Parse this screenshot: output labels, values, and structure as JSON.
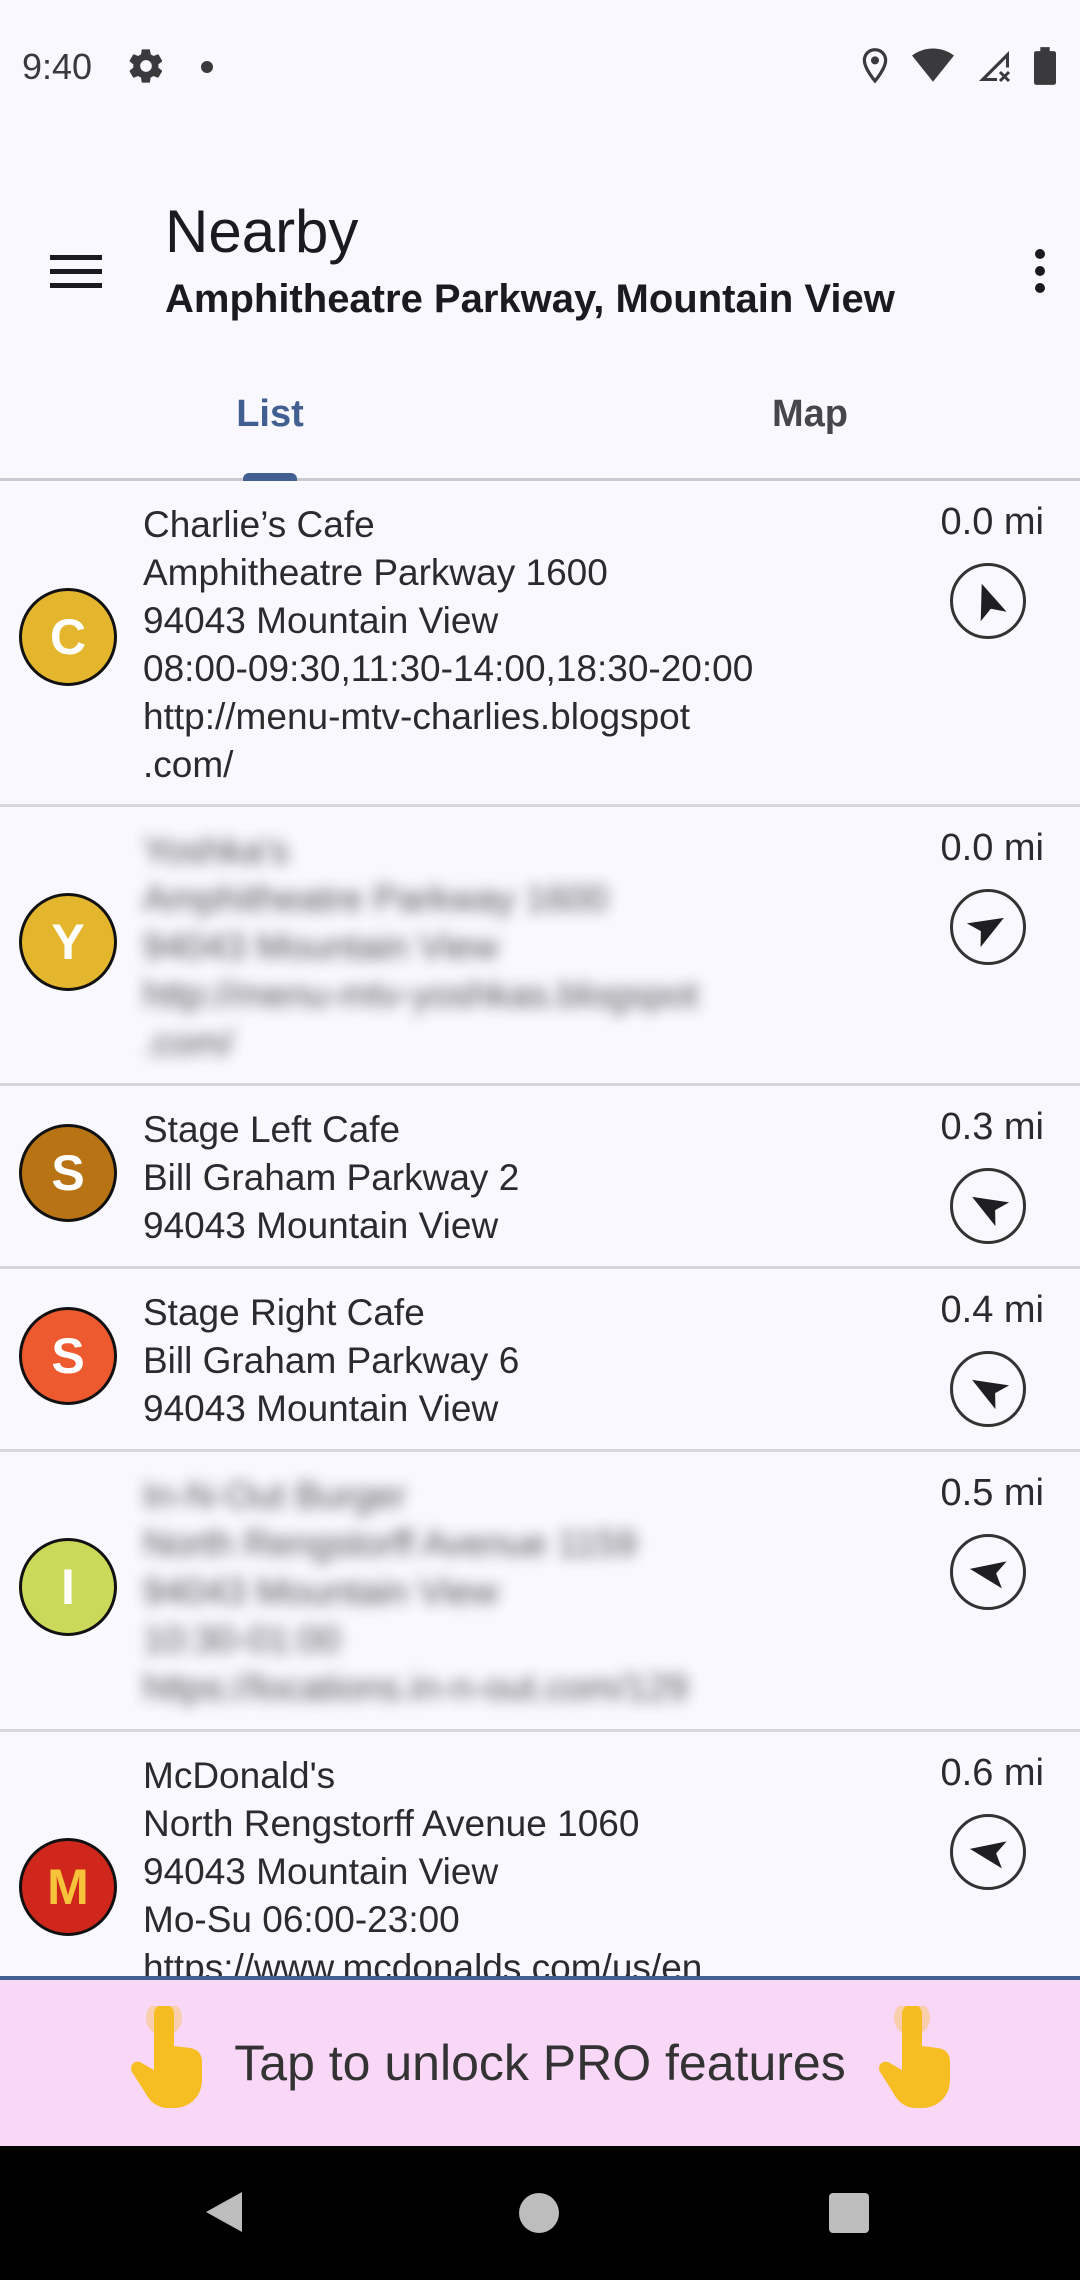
{
  "status_bar": {
    "time": "9:40",
    "icons": [
      "settings-gear-icon",
      "notification-dot-icon",
      "location-pin-icon",
      "wifi-icon",
      "signal-no-data-icon",
      "battery-icon"
    ]
  },
  "app_bar": {
    "title": "Nearby",
    "subtitle": "Amphitheatre Parkway, Mountain View",
    "menu_icon": "hamburger-menu-icon",
    "overflow_icon": "more-vertical-icon"
  },
  "tabs": [
    {
      "label": "List",
      "active": true
    },
    {
      "label": "Map",
      "active": false
    }
  ],
  "accent_color": "#415f91",
  "places": [
    {
      "letter": "C",
      "color": "#e3b62d",
      "lines": [
        "Charlie’s Cafe",
        "Amphitheatre Parkway 1600",
        "94043 Mountain View",
        "08:00-09:30,11:30-14:00,18:30-20:00",
        "http://menu-mtv-charlies.blogspot",
        ".com/"
      ],
      "distance": "0.0 mi",
      "blurred": false,
      "bearing": -20
    },
    {
      "letter": "Y",
      "color": "#e3b62d",
      "lines": [
        "Yoshka's",
        "Amphitheatre Parkway 1600",
        "94043 Mountain View",
        "http://menu-mtv-yoshkas.blogspot",
        ".com/"
      ],
      "distance": "0.0 mi",
      "blurred": true,
      "bearing": 60
    },
    {
      "letter": "S",
      "color": "#b77314",
      "lines": [
        "Stage Left Cafe",
        "Bill Graham Parkway 2",
        "94043 Mountain View"
      ],
      "distance": "0.3 mi",
      "blurred": false,
      "bearing": -60
    },
    {
      "letter": "S",
      "color": "#ee5a2f",
      "lines": [
        "Stage Right Cafe",
        "Bill Graham Parkway 6",
        "94043 Mountain View"
      ],
      "distance": "0.4 mi",
      "blurred": false,
      "bearing": -60
    },
    {
      "letter": "I",
      "color": "#cbd95a",
      "lines": [
        "In-N-Out Burger",
        "North Rengstorff Avenue 1159",
        "94043 Mountain View",
        "10:30-01:00",
        "https://locations.in-n-out.com/129"
      ],
      "distance": "0.5 mi",
      "blurred": true,
      "bearing": -80
    },
    {
      "letter": "M",
      "color": "#d0271c",
      "lines": [
        "McDonald's",
        "North Rengstorff Avenue 1060",
        "94043 Mountain View",
        "Mo-Su 06:00-23:00",
        "https://www.mcdonalds.com/us/en"
      ],
      "distance": "0.6 mi",
      "blurred": false,
      "bearing": -80
    }
  ],
  "pro_banner": {
    "text": "Tap to unlock PRO features",
    "icon": "pointing-hand-icon"
  },
  "nav_bar": {
    "icons": [
      "back-icon",
      "home-icon",
      "recents-icon"
    ]
  }
}
